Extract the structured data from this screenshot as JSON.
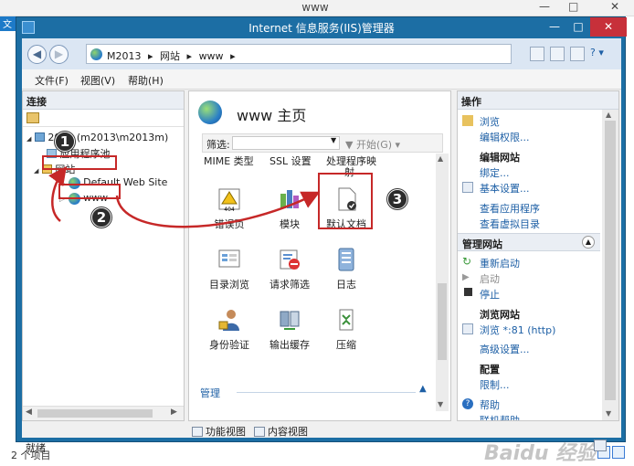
{
  "background_window": {
    "title": "www",
    "status_text": "2 个项目",
    "watermark": "Baidu 经验",
    "controls": [
      "—",
      "□",
      "✕"
    ],
    "left_tab_label": "文"
  },
  "window": {
    "title": "Internet 信息服务(IIS)管理器",
    "controls": {
      "minimize": "—",
      "maximize": "□",
      "close": "✕"
    }
  },
  "address": {
    "crumbs": [
      "M2013",
      "▸",
      "网站",
      "▸",
      "www",
      "▸"
    ],
    "help_label": "? ▾"
  },
  "menu": [
    "文件(F)",
    "视图(V)",
    "帮助(H)"
  ],
  "connections": {
    "header": "连接",
    "tree": [
      {
        "label": "2013 (m2013\\m2013m)",
        "expander": "◢"
      },
      {
        "label": "应用程序池",
        "expander": ""
      },
      {
        "label": "网站",
        "expander": "◢"
      },
      {
        "label": "Default Web Site",
        "expander": "▷"
      },
      {
        "label": "www",
        "expander": "▷"
      }
    ],
    "scroll_left": "◀",
    "scroll_right": "▶"
  },
  "main": {
    "title": "www 主页",
    "filter_label": "筛选:",
    "filter_value": "",
    "go_label": "▼ 开始(G) ▾",
    "top_row": [
      "MIME 类型",
      "SSL 设置",
      "处理程序映",
      "射"
    ],
    "features": [
      {
        "label": "错误页",
        "icon": "error-page-icon"
      },
      {
        "label": "模块",
        "icon": "modules-icon"
      },
      {
        "label": "默认文档",
        "icon": "default-document-icon"
      },
      {
        "label": "目录浏览",
        "icon": "directory-browsing-icon"
      },
      {
        "label": "请求筛选",
        "icon": "request-filtering-icon"
      },
      {
        "label": "日志",
        "icon": "logging-icon"
      },
      {
        "label": "身份验证",
        "icon": "authentication-icon"
      },
      {
        "label": "输出缓存",
        "icon": "output-caching-icon"
      },
      {
        "label": "压缩",
        "icon": "compression-icon"
      }
    ],
    "section_label": "管理",
    "section_caret": "▲",
    "tabs": [
      "功能视图",
      "内容视图"
    ]
  },
  "actions": {
    "header": "操作",
    "items": [
      {
        "label": "浏览",
        "kind": "link"
      },
      {
        "label": "编辑权限...",
        "kind": "link"
      },
      {
        "label": "编辑网站",
        "kind": "header"
      },
      {
        "label": "绑定...",
        "kind": "link"
      },
      {
        "label": "基本设置...",
        "kind": "link"
      },
      {
        "label": "查看应用程序",
        "kind": "link"
      },
      {
        "label": "查看虚拟目录",
        "kind": "link"
      }
    ],
    "manage_section": "管理网站",
    "manage_items": [
      {
        "label": "重新启动",
        "kind": "link"
      },
      {
        "label": "启动",
        "kind": "disabled"
      },
      {
        "label": "停止",
        "kind": "link"
      }
    ],
    "browse_header": "浏览网站",
    "browse_link": "浏览 *:81 (http)",
    "advanced_link": "高级设置...",
    "config_header": "配置",
    "limits_link": "限制...",
    "help_link": "帮助",
    "cut_link": "联机帮助",
    "scroll_up": "▲",
    "scroll_down": "▼",
    "collapse": "▲"
  },
  "status": {
    "text": "就绪"
  },
  "annotations": {
    "one": "1",
    "two": "2",
    "three": "3"
  },
  "colors": {
    "title_bar": "#1c6ea4",
    "close": "#c7303a",
    "link": "#1d5fa5",
    "annotation": "#c62828"
  }
}
